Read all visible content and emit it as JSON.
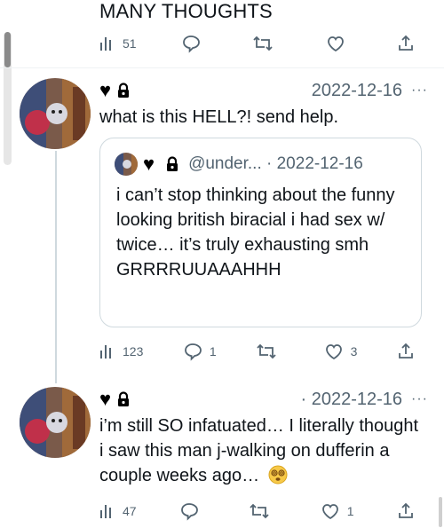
{
  "top": {
    "partial_text": "MANY THOUGHTS",
    "views": "51",
    "replies": "",
    "retweets": "",
    "likes": ""
  },
  "tweet1": {
    "date": "2022-12-16",
    "more": "···",
    "text": "what is this HELL?! send help.",
    "quote": {
      "handle": "@under... · 2022-12-16",
      "text": "i can’t stop thinking about the funny looking british biracial i had sex w/ twice… it’s truly exhausting smh GRRRRUUAAAHHH"
    },
    "views": "123",
    "replies": "1",
    "retweets": "",
    "likes": "3"
  },
  "tweet2": {
    "date": "· 2022-12-16",
    "more": "···",
    "text": "i’m still SO infatuated… I literally thought i saw this man j-walking on dufferin a couple weeks ago…",
    "views": "47",
    "replies": "",
    "retweets": "",
    "likes": "1"
  },
  "icons": {
    "views": "bar-chart-icon",
    "reply": "speech-bubble-icon",
    "retweet": "retweet-icon",
    "like": "heart-outline-icon",
    "share": "share-icon",
    "lock": "lock-icon",
    "emoji": "dizzy-face-emoji"
  },
  "colors": {
    "text": "#0f1419",
    "secondary": "#536471",
    "border": "#cfd9de"
  }
}
